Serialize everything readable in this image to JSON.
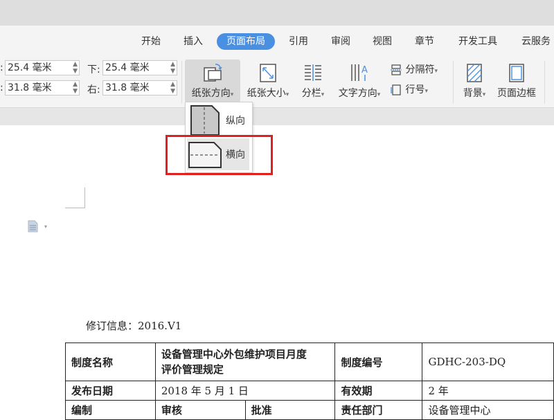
{
  "tabs": [
    {
      "label": "开始"
    },
    {
      "label": "插入"
    },
    {
      "label": "页面布局"
    },
    {
      "label": "引用"
    },
    {
      "label": "审阅"
    },
    {
      "label": "视图"
    },
    {
      "label": "章节"
    },
    {
      "label": "开发工具"
    },
    {
      "label": "云服务"
    }
  ],
  "margins": {
    "top_value": "25.4 毫米",
    "left_value": "31.8 毫米",
    "bottom_label": "下:",
    "bottom_value": "25.4 毫米",
    "right_label": "右:",
    "right_value": "31.8 毫米",
    "top_label": ":",
    "left_label": ":"
  },
  "ribbon": {
    "orientation": "纸张方向",
    "paper_size": "纸张大小",
    "columns": "分栏",
    "text_direction": "文字方向",
    "separator": "分隔符",
    "line_number": "行号",
    "background": "背景",
    "page_border": "页面边框"
  },
  "dropdown": {
    "portrait": "纵向",
    "landscape": "横向"
  },
  "document": {
    "revision": "修订信息：2016.V1",
    "table": {
      "r1c1": "制度名称",
      "r1c2a": "设备管理中心外包维护项目月度",
      "r1c2b": "评价管理规定",
      "r1c3": "制度编号",
      "r1c4": "GDHC-203-DQ",
      "r2c1": "发布日期",
      "r2c2": "2018 年 5 月 1 日",
      "r2c3": "有效期",
      "r2c4": "2 年",
      "r3c1": "编制",
      "r3c2": "审核",
      "r3c3": "批准",
      "r3c4": "责任部门",
      "r3c5": "设备管理中心"
    }
  },
  "colors": {
    "accent": "#4a90e2",
    "highlight": "#e02020"
  }
}
